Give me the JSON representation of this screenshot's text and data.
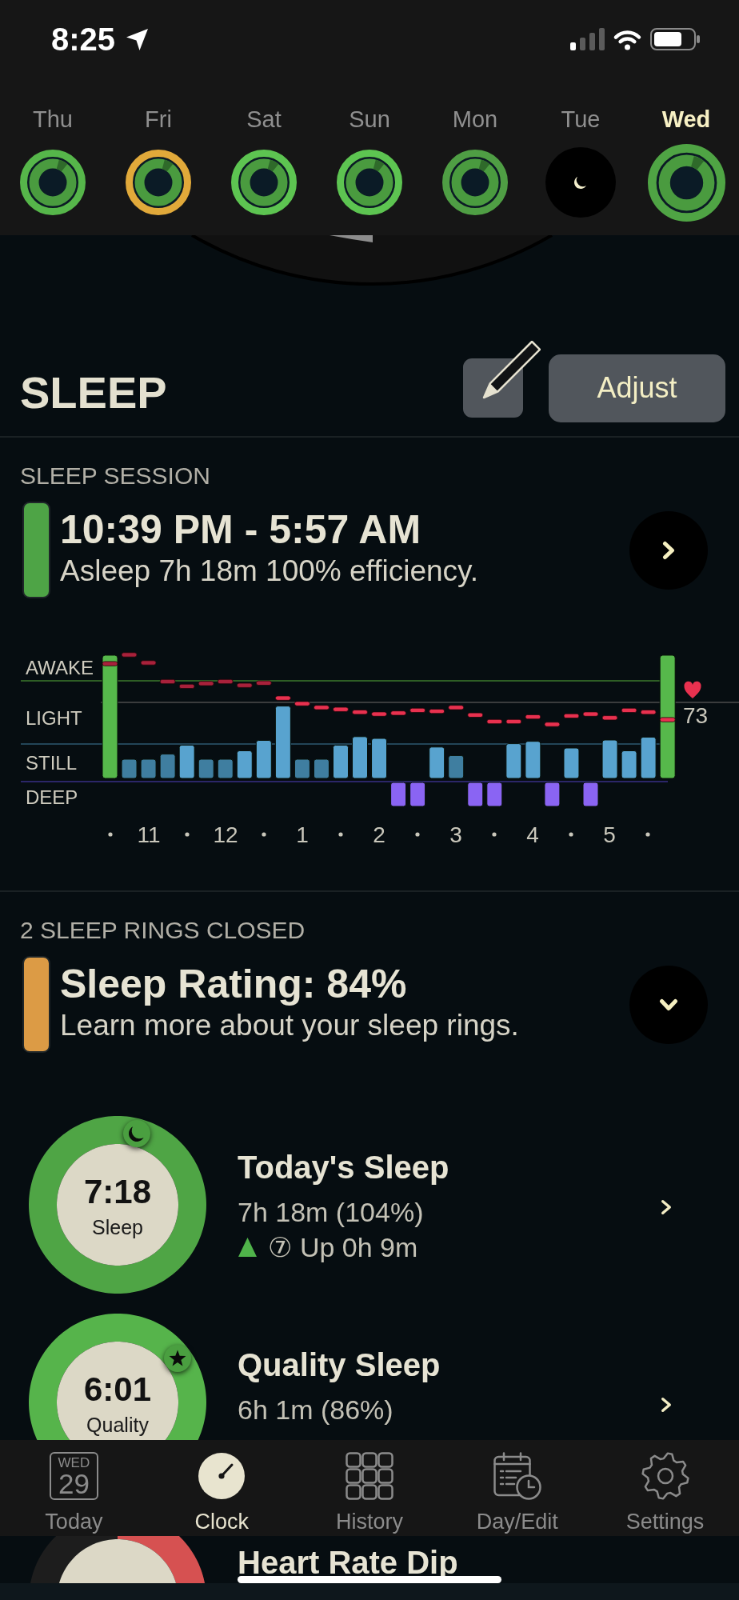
{
  "status_bar": {
    "time": "8:25"
  },
  "days": [
    {
      "label": "Thu",
      "selected": false,
      "kind": "rings",
      "color": "#56b64a"
    },
    {
      "label": "Fri",
      "selected": false,
      "kind": "rings",
      "color": "#e1a93a"
    },
    {
      "label": "Sat",
      "selected": false,
      "kind": "rings",
      "color": "#5dc451"
    },
    {
      "label": "Sun",
      "selected": false,
      "kind": "rings",
      "color": "#5dc451"
    },
    {
      "label": "Mon",
      "selected": false,
      "kind": "rings",
      "color": "#4f9e44"
    },
    {
      "label": "Tue",
      "selected": false,
      "kind": "moon"
    },
    {
      "label": "Wed",
      "selected": true,
      "kind": "rings",
      "color": "#4fa444"
    }
  ],
  "sleep": {
    "title": "SLEEP",
    "adjust_label": "Adjust",
    "session": {
      "label": "SLEEP SESSION",
      "color": "#4ea446",
      "time_range": "10:39 PM - 5:57 AM",
      "summary": "Asleep 7h 18m 100% efficiency."
    },
    "chart": {
      "stage_labels": [
        "AWAKE",
        "LIGHT",
        "STILL",
        "DEEP"
      ],
      "hour_labels": [
        "11",
        "12",
        "1",
        "2",
        "3",
        "4",
        "5"
      ],
      "heart_rate": "73"
    }
  },
  "rings_summary": {
    "label": "2 SLEEP RINGS CLOSED",
    "color": "#dc9b45",
    "title": "Sleep Rating: 84%",
    "subtitle": "Learn more about your sleep rings."
  },
  "rings": [
    {
      "kind": "moon",
      "value": "7:18",
      "caption": "Sleep",
      "title": "Today's Sleep",
      "detail": "7h 18m (104%)",
      "trend_up": true,
      "trend_text": "⑦ Up 0h 9m",
      "color": "#4fa545",
      "level": 1
    },
    {
      "kind": "star",
      "value": "6:01",
      "caption": "Quality",
      "title": "Quality Sleep",
      "detail": "6h 1m (86%)",
      "color": "#56b44b",
      "level": 1
    },
    {
      "kind": "none",
      "title": "Heart Rate Dip",
      "color": "#d65151",
      "level": 0.5
    }
  ],
  "tabs": [
    {
      "label": "Today",
      "selected": false,
      "kind": "date",
      "weekday": "WED",
      "day": "29"
    },
    {
      "label": "Clock",
      "selected": true,
      "kind": "icon"
    },
    {
      "label": "History",
      "selected": false,
      "kind": "icon"
    },
    {
      "label": "Day/Edit",
      "selected": false,
      "kind": "icon"
    },
    {
      "label": "Settings",
      "selected": false,
      "kind": "icon"
    }
  ]
}
